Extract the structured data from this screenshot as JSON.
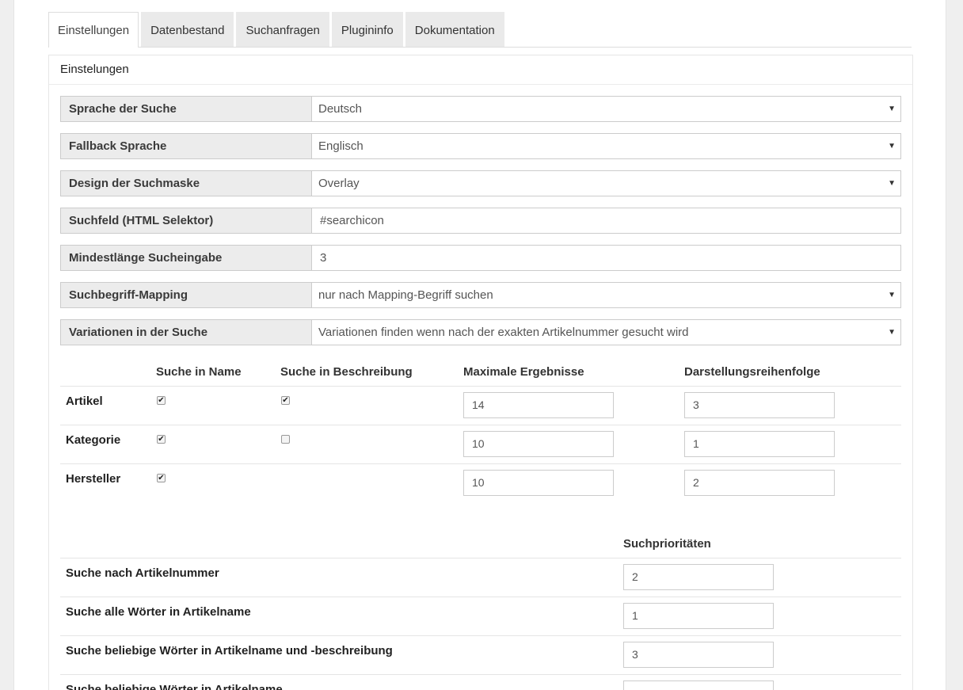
{
  "tabs": [
    "Einstellungen",
    "Datenbestand",
    "Suchanfragen",
    "Plugininfo",
    "Dokumentation"
  ],
  "panel_title": "Einstelungen",
  "settings": [
    {
      "label": "Sprache der Suche",
      "value": "Deutsch",
      "type": "select"
    },
    {
      "label": "Fallback Sprache",
      "value": "Englisch",
      "type": "select"
    },
    {
      "label": "Design der Suchmaske",
      "value": "Overlay",
      "type": "select"
    },
    {
      "label": "Suchfeld (HTML Selektor)",
      "value": "#searchicon",
      "type": "input"
    },
    {
      "label": "Mindestlänge Sucheingabe",
      "value": "3",
      "type": "input"
    },
    {
      "label": "Suchbegriff-Mapping",
      "value": "nur nach Mapping-Begriff suchen",
      "type": "select"
    },
    {
      "label": "Variationen in der Suche",
      "value": "Variationen finden wenn nach der exakten Artikelnummer gesucht wird",
      "type": "select"
    }
  ],
  "caret": "▼",
  "search_table": {
    "headers": [
      "Suche in Name",
      "Suche in Beschreibung",
      "Maximale Ergebnisse",
      "Darstellungsreihenfolge"
    ],
    "rows": [
      {
        "label": "Artikel",
        "in_name": true,
        "in_desc": true,
        "max_results": "14",
        "order": "3"
      },
      {
        "label": "Kategorie",
        "in_name": true,
        "in_desc": false,
        "max_results": "10",
        "order": "1"
      },
      {
        "label": "Hersteller",
        "in_name": true,
        "in_desc": null,
        "max_results": "10",
        "order": "2"
      }
    ]
  },
  "priorities": {
    "header": "Suchprioritäten",
    "rows": [
      {
        "label": "Suche nach Artikelnummer",
        "value": "2"
      },
      {
        "label": "Suche alle Wörter in Artikelname",
        "value": "1"
      },
      {
        "label": "Suche beliebige Wörter in Artikelname und -beschreibung",
        "value": "3"
      },
      {
        "label": "Suche beliebige Wörter in Artikelname",
        "value": ""
      }
    ]
  }
}
